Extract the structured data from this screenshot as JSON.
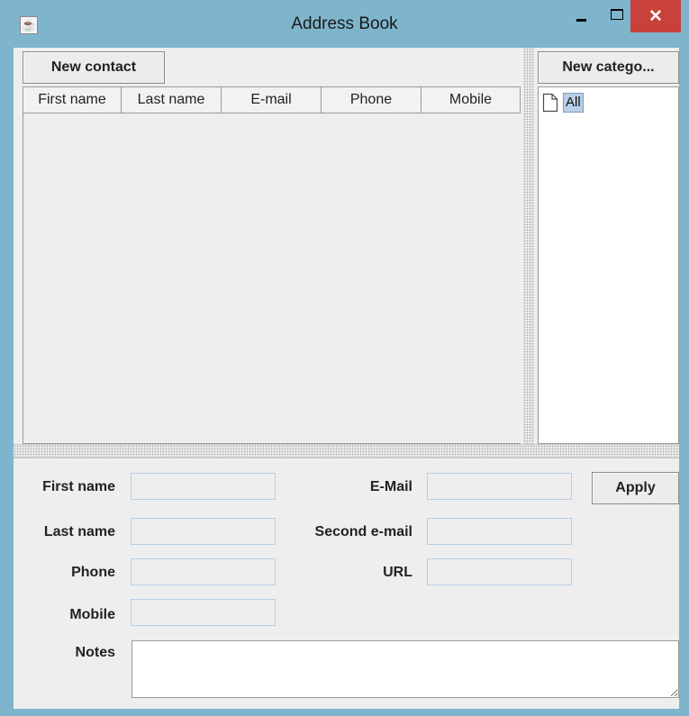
{
  "window": {
    "title": "Address Book",
    "icon": "java-cup-icon",
    "minimize_icon": "minimize-icon",
    "maximize_icon": "maximize-icon",
    "close_icon": "close-icon",
    "close_glyph": "✕"
  },
  "toolbar": {
    "new_contact_label": "New contact",
    "new_category_label": "New catego..."
  },
  "contacts_table": {
    "columns": [
      "First name",
      "Last name",
      "E-mail",
      "Phone",
      "Mobile"
    ],
    "rows": []
  },
  "categories_tree": {
    "nodes": [
      {
        "label": "All",
        "icon": "document-icon",
        "selected": true
      }
    ]
  },
  "form": {
    "first_name_label": "First name",
    "last_name_label": "Last name",
    "phone_label": "Phone",
    "mobile_label": "Mobile",
    "notes_label": "Notes",
    "email_label": "E-Mail",
    "second_email_label": "Second e-mail",
    "url_label": "URL",
    "apply_label": "Apply",
    "first_name_value": "",
    "last_name_value": "",
    "phone_value": "",
    "mobile_value": "",
    "email_value": "",
    "second_email_value": "",
    "url_value": "",
    "notes_value": ""
  },
  "colors": {
    "frame": "#7fb5cc",
    "close_button": "#c8413a",
    "selection": "#b8cfe5",
    "field_border": "#b8cfe5"
  }
}
